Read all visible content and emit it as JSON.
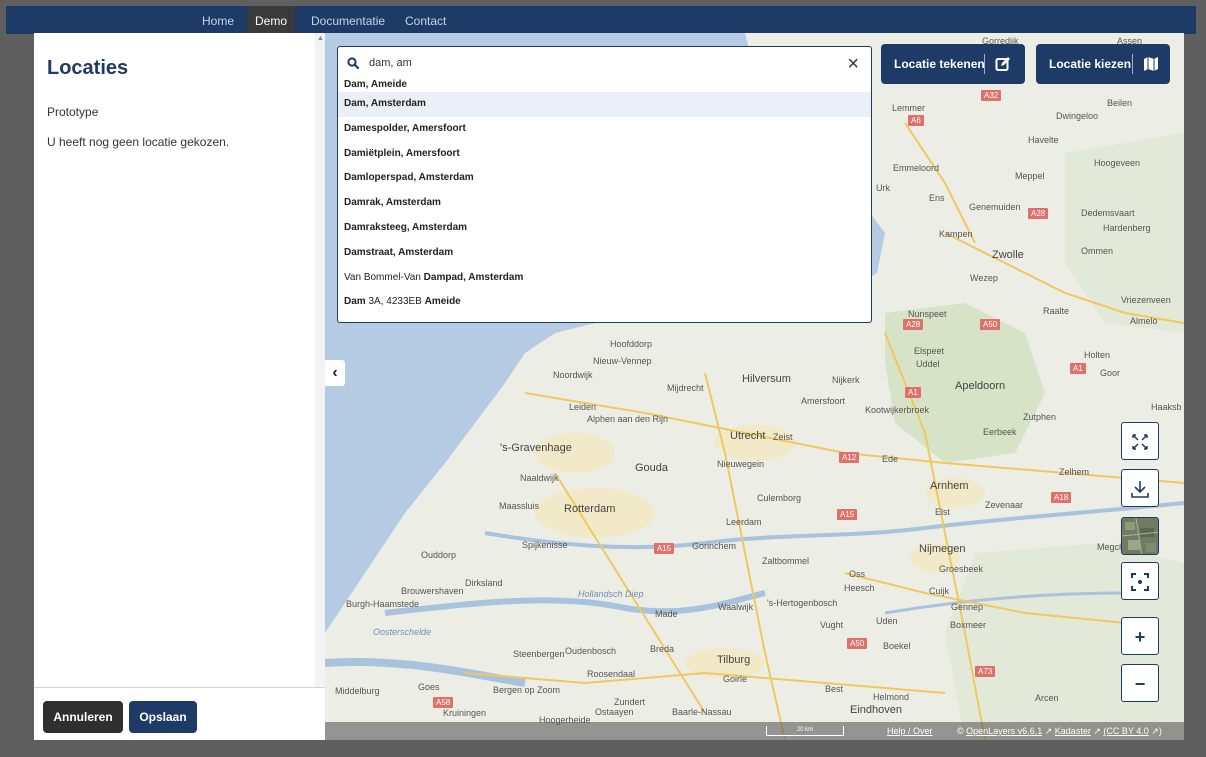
{
  "nav": {
    "items": [
      {
        "label": "Home",
        "active": false
      },
      {
        "label": "Demo",
        "active": true
      },
      {
        "label": "Documentatie",
        "active": false
      },
      {
        "label": "Contact",
        "active": false
      }
    ]
  },
  "panel": {
    "title": "Locaties",
    "subtitle": "Prototype",
    "message": "U heeft nog geen locatie gekozen.",
    "cancel_label": "Annuleren",
    "save_label": "Opslaan"
  },
  "search": {
    "value": "dam, am",
    "results": [
      {
        "pre": "",
        "bold": "Dam, Ameide",
        "post": ""
      },
      {
        "pre": "",
        "bold": "Dam, Amsterdam",
        "post": ""
      },
      {
        "pre": "",
        "bold": "Damespolder, Amersfoort",
        "post": ""
      },
      {
        "pre": "",
        "bold": "Damiëtplein, Amersfoort",
        "post": ""
      },
      {
        "pre": "",
        "bold": "Damloperspad, Amsterdam",
        "post": ""
      },
      {
        "pre": "",
        "bold": "Damrak, Amsterdam",
        "post": ""
      },
      {
        "pre": "",
        "bold": "Damraksteeg, Amsterdam",
        "post": ""
      },
      {
        "pre": "",
        "bold": "Damstraat, Amsterdam",
        "post": ""
      },
      {
        "pre": "Van Bommel-Van ",
        "bold": "Dampad, Amsterdam",
        "post": ""
      },
      {
        "pre": "",
        "bold": "Dam",
        "post": " 3A, 4233EB ",
        "bold2": "Ameide"
      }
    ]
  },
  "map_buttons": {
    "draw_label": "Locatie tekenen",
    "choose_label": "Locatie kiezen"
  },
  "map_controls": {
    "zoom_in": "+",
    "zoom_out": "−"
  },
  "map_labels": [
    {
      "text": "Lemmer"
    },
    {
      "text": "Beilen"
    },
    {
      "text": "Dwingeloo"
    },
    {
      "text": "Havelte"
    },
    {
      "text": "Emmeloord"
    },
    {
      "text": "Meppel"
    },
    {
      "text": "Hoogeveen"
    },
    {
      "text": "Urk"
    },
    {
      "text": "Ens"
    },
    {
      "text": "Genemuiden"
    },
    {
      "text": "Dedemsvaart"
    },
    {
      "text": "Hardenberg"
    },
    {
      "text": "Kampen"
    },
    {
      "text": "Zwolle"
    },
    {
      "text": "Ommen"
    },
    {
      "text": "Wezep"
    },
    {
      "text": "Vriezenveen"
    },
    {
      "text": "Nunspeet"
    },
    {
      "text": "Raalte"
    },
    {
      "text": "Almelo"
    },
    {
      "text": "Hoofddorp"
    },
    {
      "text": "Nieuw-Vennep"
    },
    {
      "text": "Elspeet"
    },
    {
      "text": "Uddel"
    },
    {
      "text": "Holten"
    },
    {
      "text": "Noordwijk"
    },
    {
      "text": "Hilversum"
    },
    {
      "text": "Nijkerk"
    },
    {
      "text": "Apeldoorn"
    },
    {
      "text": "Goor"
    },
    {
      "text": "Mijdrecht"
    },
    {
      "text": "Amersfoort"
    },
    {
      "text": "Kootwijkerbroek"
    },
    {
      "text": "Leiden"
    },
    {
      "text": "Alphen aan den Rijn"
    },
    {
      "text": "Zutphen"
    },
    {
      "text": "Haaksb"
    },
    {
      "text": "Utrecht"
    },
    {
      "text": "Zeist"
    },
    {
      "text": "Eerbeek"
    },
    {
      "text": "'s-Gravenhage"
    },
    {
      "text": "Ede"
    },
    {
      "text": "Naaldwijk"
    },
    {
      "text": "Gouda"
    },
    {
      "text": "Nieuwegein"
    },
    {
      "text": "Zelhem"
    },
    {
      "text": "Arnhem"
    },
    {
      "text": "Maassluis"
    },
    {
      "text": "Rotterdam"
    },
    {
      "text": "Culemborg"
    },
    {
      "text": "Zevenaar"
    },
    {
      "text": "Elst"
    },
    {
      "text": "Leerdam"
    },
    {
      "text": "Spijkenisse"
    },
    {
      "text": "Gorinchem"
    },
    {
      "text": "Nijmegen"
    },
    {
      "text": "Megchelen"
    },
    {
      "text": "Zaltbommel"
    },
    {
      "text": "Groesbeek"
    },
    {
      "text": "Ouddorp"
    },
    {
      "text": "Dirksland"
    },
    {
      "text": "Oss"
    },
    {
      "text": "Heesch"
    },
    {
      "text": "Cuijk"
    },
    {
      "text": "Brouwershaven"
    },
    {
      "text": "Burgh-Haamstede"
    },
    {
      "text": "Made"
    },
    {
      "text": "Waalwijk"
    },
    {
      "text": "'s-Hertogenbosch"
    },
    {
      "text": "Gennep"
    },
    {
      "text": "Vught"
    },
    {
      "text": "Uden"
    },
    {
      "text": "Boxmeer"
    },
    {
      "text": "Breda"
    },
    {
      "text": "Steenbergen"
    },
    {
      "text": "Oudenbosch"
    },
    {
      "text": "Tilburg"
    },
    {
      "text": "Boekel"
    },
    {
      "text": "Roosendaal"
    },
    {
      "text": "Goirle"
    },
    {
      "text": "Middelburg"
    },
    {
      "text": "Goes"
    },
    {
      "text": "Bergen op Zoom"
    },
    {
      "text": "Best"
    },
    {
      "text": "Helmond"
    },
    {
      "text": "Arcen"
    },
    {
      "text": "Zundert"
    },
    {
      "text": "Ostaayen"
    },
    {
      "text": "Baarle-Nassau"
    },
    {
      "text": "Eindhoven"
    },
    {
      "text": "Kruiningen"
    },
    {
      "text": "Hoogerheide"
    },
    {
      "text": "Oosterschelde"
    },
    {
      "text": "Hollandsch Diep"
    },
    {
      "text": "Gorredijk"
    },
    {
      "text": "Assen"
    }
  ],
  "map_shields": [
    {
      "text": "A32"
    },
    {
      "text": "A6"
    },
    {
      "text": "A28"
    },
    {
      "text": "A28"
    },
    {
      "text": "A50"
    },
    {
      "text": "A1"
    },
    {
      "text": "A1"
    },
    {
      "text": "A12"
    },
    {
      "text": "A18"
    },
    {
      "text": "A15"
    },
    {
      "text": "A15"
    },
    {
      "text": "A50"
    },
    {
      "text": "A73"
    },
    {
      "text": "A58"
    }
  ],
  "attribution": {
    "scale": "20 km",
    "help": "Help / Over",
    "copyright": "©",
    "openlayers": "OpenLayers v6.6.1",
    "kadaster": "Kadaster",
    "license": "(CC BY 4.0"
  },
  "colors": {
    "primary": "#1d3b66",
    "dark_button": "#2f2f2f",
    "water": "#b5cbe3",
    "land": "#eef0e8"
  }
}
